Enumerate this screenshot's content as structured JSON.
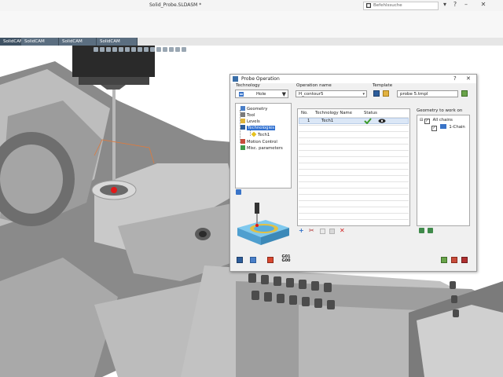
{
  "window": {
    "title": "Solid_Probe.SLDASM *",
    "search_placeholder": "Befehlssuche"
  },
  "cam_tabs": [
    {
      "label": "SolidCAM 3D"
    },
    {
      "label": "SolidCAM Multiaxis"
    },
    {
      "label": "SolidCAM Turning"
    },
    {
      "label": "SolidCAM Templates"
    }
  ],
  "dialog": {
    "title": "Probe Operation",
    "help": "?",
    "close": "✕",
    "technology_label": "Technology",
    "technology_value": "Hole",
    "operation_name_label": "Operation name",
    "operation_name_value": "H_contour5",
    "template_label": "Template",
    "template_value": "probe 5.tmpl",
    "tree": [
      {
        "label": "Geometry"
      },
      {
        "label": "Tool"
      },
      {
        "label": "Levels"
      },
      {
        "label": "Technologies"
      },
      {
        "label": "Tech1"
      },
      {
        "label": "Motion Control"
      },
      {
        "label": "Misc. parameters"
      }
    ],
    "table": {
      "headers": [
        "No.",
        "Technology Name",
        "Status"
      ],
      "rows": [
        {
          "no": "1",
          "name": "Tech1"
        }
      ]
    },
    "geometry_label": "Geometry to work on",
    "geometry_tree": [
      {
        "label": "All chains"
      },
      {
        "label": "1-Chain"
      }
    ],
    "gcode_label": "G01\nG00"
  }
}
